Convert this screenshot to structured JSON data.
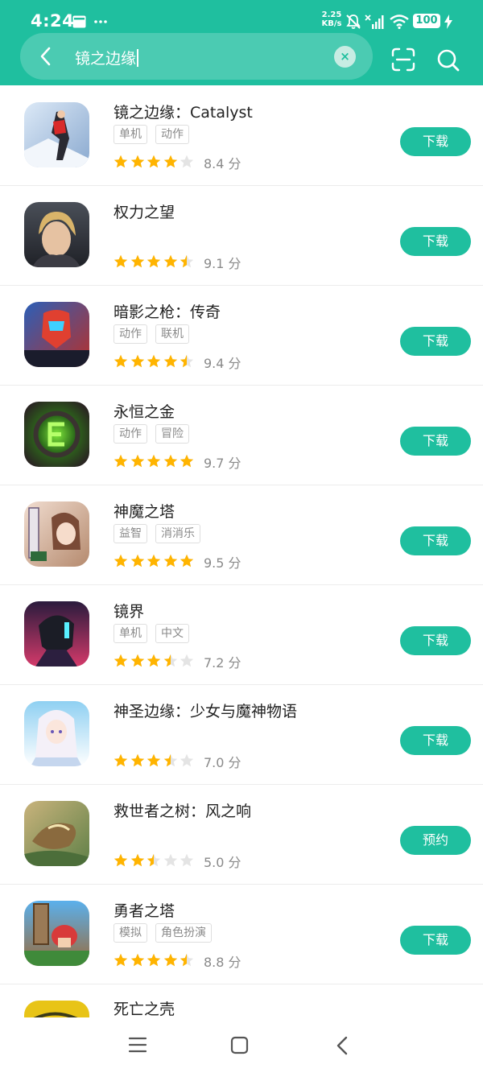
{
  "status_bar": {
    "time": "4:24",
    "net_speed_value": "2.25",
    "net_speed_unit": "KB/s",
    "battery": "100",
    "icons": [
      "email-icon",
      "more-dots-icon",
      "mute-icon",
      "no-signal-icon",
      "wifi-icon",
      "charging-icon"
    ]
  },
  "search": {
    "query": "镜之边缘",
    "back_icon": "back-arrow-icon",
    "clear_icon": "clear-icon",
    "clear_glyph": "×",
    "scan_icon": "scan-icon",
    "search_icon": "search-icon"
  },
  "colors": {
    "accent": "#1fbf9f",
    "star_filled": "#ffb400",
    "star_empty": "#e4e4e4"
  },
  "apps": [
    {
      "name": "镜之边缘：Catalyst",
      "tags": [
        "单机",
        "动作"
      ],
      "rating": 4.0,
      "score": "8.4 分",
      "action": "下载"
    },
    {
      "name": "权力之望",
      "tags": [],
      "rating": 4.5,
      "score": "9.1 分",
      "action": "下载"
    },
    {
      "name": "暗影之枪：传奇",
      "tags": [
        "动作",
        "联机"
      ],
      "rating": 4.5,
      "score": "9.4 分",
      "action": "下载"
    },
    {
      "name": "永恒之金",
      "tags": [
        "动作",
        "冒险"
      ],
      "rating": 5.0,
      "score": "9.7 分",
      "action": "下载"
    },
    {
      "name": "神魔之塔",
      "tags": [
        "益智",
        "消消乐"
      ],
      "rating": 5.0,
      "score": "9.5 分",
      "action": "下载"
    },
    {
      "name": "镜界",
      "tags": [
        "单机",
        "中文"
      ],
      "rating": 3.5,
      "score": "7.2 分",
      "action": "下载"
    },
    {
      "name": "神圣边缘：少女与魔神物语",
      "tags": [],
      "rating": 3.5,
      "score": "7.0 分",
      "action": "下载"
    },
    {
      "name": "救世者之树：风之响",
      "tags": [],
      "rating": 2.5,
      "score": "5.0 分",
      "action": "预约"
    },
    {
      "name": "勇者之塔",
      "tags": [
        "模拟",
        "角色扮演"
      ],
      "rating": 4.5,
      "score": "8.8 分",
      "action": "下载"
    },
    {
      "name": "死亡之壳",
      "tags": [],
      "rating": 0,
      "score": "",
      "action": ""
    }
  ],
  "nav_bar": {
    "icons": [
      "menu-icon",
      "home-icon",
      "back-icon"
    ]
  }
}
